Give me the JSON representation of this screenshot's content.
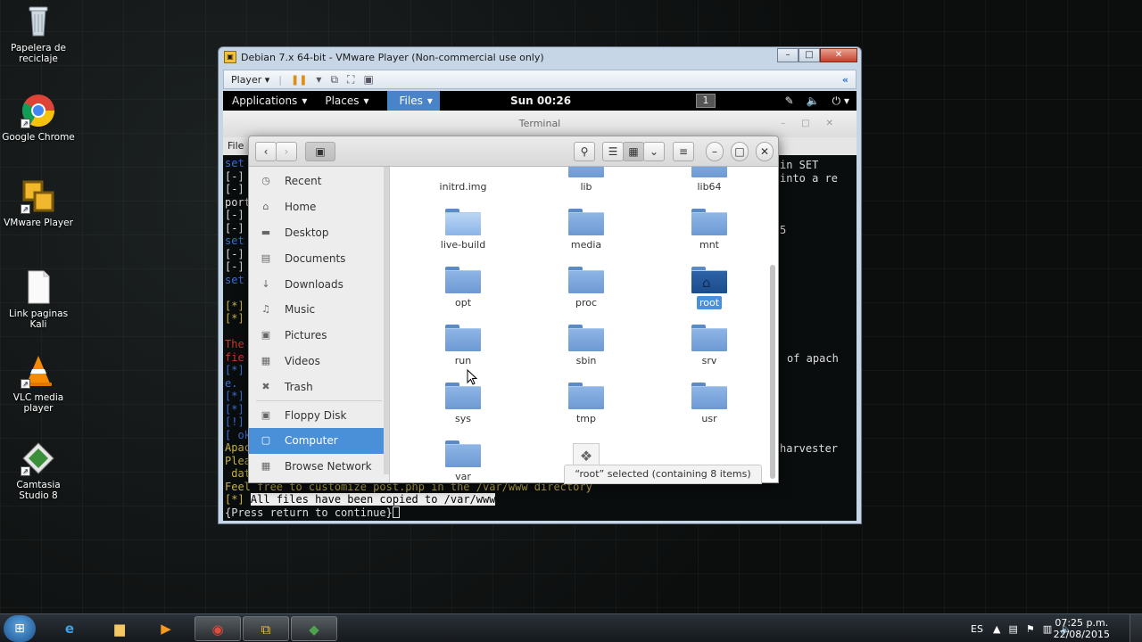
{
  "desktop": {
    "icons": [
      {
        "label": "Papelera de reciclaje",
        "icon": "recycle-bin-icon"
      },
      {
        "label": "Google Chrome",
        "icon": "chrome-icon"
      },
      {
        "label": "VMware Player",
        "icon": "vmware-icon"
      },
      {
        "label": "Link paginas Kali",
        "icon": "text-file-icon"
      },
      {
        "label": "VLC media player",
        "icon": "vlc-icon"
      },
      {
        "label": "Camtasia Studio 8",
        "icon": "camtasia-icon"
      }
    ]
  },
  "vmware": {
    "title": "Debian 7.x 64-bit - VMware Player (Non-commercial use only)",
    "player_menu": "Player",
    "controls": {
      "minimize": "–",
      "maximize": "□",
      "close": "✕"
    }
  },
  "gnome_bar": {
    "applications": "Applications",
    "places": "Places",
    "files": "Files",
    "clock": "Sun 00:26",
    "workspace": "1"
  },
  "terminal": {
    "title": "Terminal",
    "menu_fragment": "File",
    "left_lines": [
      {
        "text": "set",
        "cls": "blue"
      },
      {
        "text": "[-]",
        "cls": "white"
      },
      {
        "text": "[-]",
        "cls": "white"
      },
      {
        "text": "port",
        "cls": "white"
      },
      {
        "text": "[-]",
        "cls": "white"
      },
      {
        "text": "[-]",
        "cls": "white"
      },
      {
        "text": "set",
        "cls": "blue"
      },
      {
        "text": "[-]",
        "cls": "white"
      },
      {
        "text": "[-]",
        "cls": "white"
      },
      {
        "text": "set",
        "cls": "blue"
      },
      {
        "text": "",
        "cls": "white"
      },
      {
        "text": "[*]",
        "cls": "yellow"
      },
      {
        "text": "[*]",
        "cls": "yellow"
      },
      {
        "text": "",
        "cls": "white"
      },
      {
        "text": "The",
        "cls": "red"
      },
      {
        "text": "fie",
        "cls": "red"
      },
      {
        "text": "[*]",
        "cls": "blue"
      },
      {
        "text": "e.",
        "cls": "blue"
      },
      {
        "text": "[*]",
        "cls": "blue"
      },
      {
        "text": "[*]",
        "cls": "blue"
      },
      {
        "text": "[!]",
        "cls": "blue"
      },
      {
        "text": "[ ok",
        "cls": "blue"
      },
      {
        "text": "Apac",
        "cls": "yellow"
      },
      {
        "text": "Plea",
        "cls": "yellow"
      },
      {
        "text": " dat",
        "cls": "yellow"
      },
      {
        "text": "Feel free to customize post.php in the /var/www directory",
        "cls": "yellow"
      }
    ],
    "right_fragments": [
      "in SET",
      "into a re",
      "5",
      "of apach",
      "harvester"
    ],
    "copied_prefix": "[*]",
    "copied_msg": "All files have been copied to /var/www",
    "prompt": "{Press return to continue}"
  },
  "files_window": {
    "sidebar": [
      {
        "label": "Recent",
        "icon": "clock-icon",
        "glyph": "◷"
      },
      {
        "label": "Home",
        "icon": "home-icon",
        "glyph": "⌂"
      },
      {
        "label": "Desktop",
        "icon": "desktop-folder-icon",
        "glyph": "▬"
      },
      {
        "label": "Documents",
        "icon": "documents-icon",
        "glyph": "▤"
      },
      {
        "label": "Downloads",
        "icon": "downloads-icon",
        "glyph": "↓"
      },
      {
        "label": "Music",
        "icon": "music-icon",
        "glyph": "♫"
      },
      {
        "label": "Pictures",
        "icon": "pictures-icon",
        "glyph": "▣"
      },
      {
        "label": "Videos",
        "icon": "videos-icon",
        "glyph": "▦"
      },
      {
        "label": "Trash",
        "icon": "trash-icon",
        "glyph": "✖"
      }
    ],
    "devices": [
      {
        "label": "Floppy Disk",
        "icon": "floppy-icon",
        "glyph": "▣"
      },
      {
        "label": "Computer",
        "icon": "computer-icon",
        "glyph": "▢"
      },
      {
        "label": "Browse Network",
        "icon": "network-icon",
        "glyph": "▦"
      }
    ],
    "items": [
      {
        "name": "initrd.img",
        "kind": "file"
      },
      {
        "name": "lib",
        "kind": "folder"
      },
      {
        "name": "lib64",
        "kind": "folder"
      },
      {
        "name": "live-build",
        "kind": "folder-light"
      },
      {
        "name": "media",
        "kind": "folder"
      },
      {
        "name": "mnt",
        "kind": "folder"
      },
      {
        "name": "opt",
        "kind": "folder"
      },
      {
        "name": "proc",
        "kind": "folder"
      },
      {
        "name": "root",
        "kind": "folder-home",
        "selected": true
      },
      {
        "name": "run",
        "kind": "folder"
      },
      {
        "name": "sbin",
        "kind": "folder"
      },
      {
        "name": "srv",
        "kind": "folder"
      },
      {
        "name": "sys",
        "kind": "folder"
      },
      {
        "name": "tmp",
        "kind": "folder"
      },
      {
        "name": "usr",
        "kind": "folder"
      },
      {
        "name": "var",
        "kind": "folder"
      },
      {
        "name": "",
        "kind": "executable"
      }
    ],
    "status": "“root” selected (containing 8 items)"
  },
  "taskbar": {
    "language": "ES",
    "time": "07:25 p.m.",
    "date": "22/08/2015",
    "apps": [
      "windows-explorer-ie-icon",
      "file-explorer-icon",
      "media-player-icon",
      "chrome-icon",
      "vmware-icon",
      "camtasia-icon"
    ]
  }
}
